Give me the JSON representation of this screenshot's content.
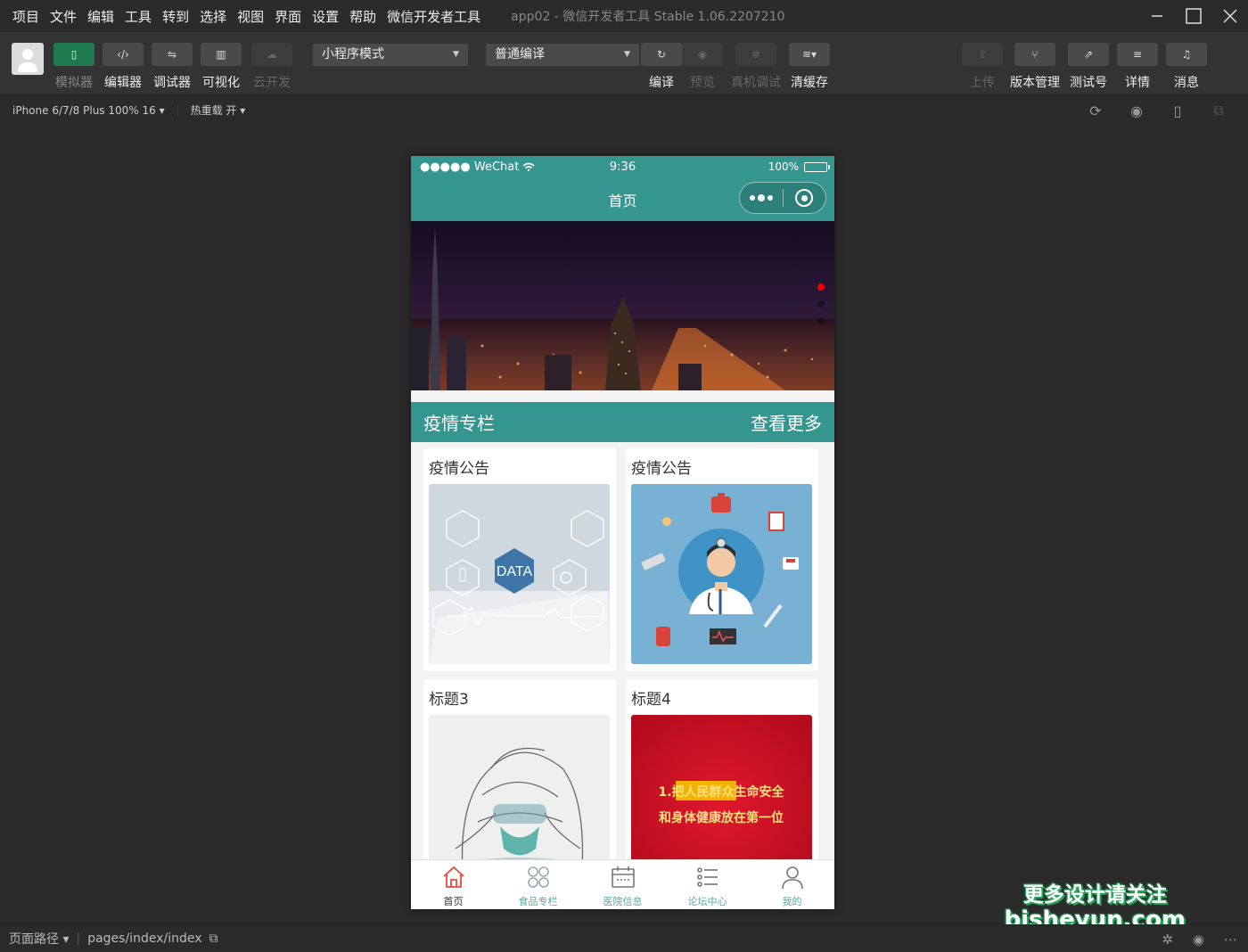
{
  "menubar": {
    "items": [
      "项目",
      "文件",
      "编辑",
      "工具",
      "转到",
      "选择",
      "视图",
      "界面",
      "设置",
      "帮助",
      "微信开发者工具"
    ],
    "window_title": "app02 - 微信开发者工具 Stable 1.06.2207210"
  },
  "toolbar": {
    "simulator": "模拟器",
    "editor": "编辑器",
    "debugger": "调试器",
    "visual": "可视化",
    "cloud": "云开发",
    "mode_select": "小程序模式",
    "compile_select": "普通编译",
    "compile": "编译",
    "preview": "预览",
    "real_debug": "真机调试",
    "clear_cache": "清缓存",
    "upload": "上传",
    "version": "版本管理",
    "test_account": "测试号",
    "details": "详情",
    "messages": "消息"
  },
  "subbar": {
    "device": "iPhone 6/7/8 Plus 100% 16 ▾",
    "hot_reload": "热重载 开 ▾"
  },
  "phone": {
    "carrier": "●●●●● WeChat",
    "time": "9:36",
    "battery": "100%",
    "nav_title": "首页",
    "section_title": "疫情专栏",
    "section_more": "查看更多",
    "cards": [
      {
        "title": "疫情公告",
        "image": "data-hexagon-photo"
      },
      {
        "title": "疫情公告",
        "image": "doctor-illustration"
      },
      {
        "title": "标题3",
        "image": "medic-sketch"
      },
      {
        "title": "标题4",
        "image": "red-slogan-banner"
      }
    ],
    "slogan_line1": "1.把人民群众生命安全",
    "slogan_line2": "和身体健康放在第一位",
    "data_label": "DATA",
    "tabs": [
      {
        "label": "首页",
        "icon": "home-icon"
      },
      {
        "label": "食品专栏",
        "icon": "grid-icon"
      },
      {
        "label": "医院信息",
        "icon": "calendar-icon"
      },
      {
        "label": "论坛中心",
        "icon": "list-icon"
      },
      {
        "label": "我的",
        "icon": "user-icon"
      }
    ],
    "accent": "#35968f",
    "tab_active": "#e74c3c"
  },
  "statusbar": {
    "path_label": "页面路径 ▾",
    "path": "pages/index/index"
  },
  "watermark": {
    "line1": "更多设计请关注",
    "line2": "bisheyun.com"
  }
}
